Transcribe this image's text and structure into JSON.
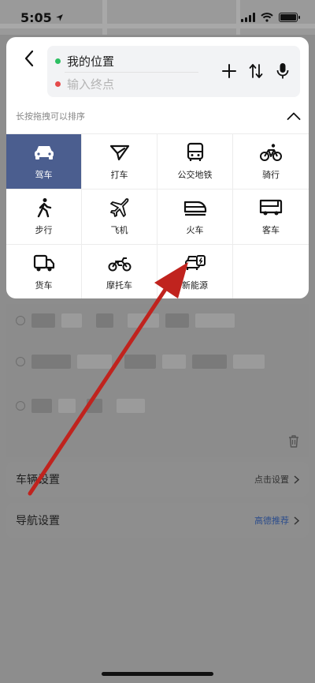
{
  "status": {
    "time": "5:05"
  },
  "route": {
    "start_label": "我的位置",
    "end_placeholder": "输入终点"
  },
  "hint": "长按拖拽可以排序",
  "modes": [
    {
      "label": "驾车",
      "icon": "car-icon",
      "active": true
    },
    {
      "label": "打车",
      "icon": "taxi-icon",
      "active": false
    },
    {
      "label": "公交地铁",
      "icon": "bus-icon",
      "active": false
    },
    {
      "label": "骑行",
      "icon": "bicycle-icon",
      "active": false
    },
    {
      "label": "步行",
      "icon": "walking-icon",
      "active": false
    },
    {
      "label": "飞机",
      "icon": "airplane-icon",
      "active": false
    },
    {
      "label": "火车",
      "icon": "train-icon",
      "active": false
    },
    {
      "label": "客车",
      "icon": "coach-icon",
      "active": false
    },
    {
      "label": "货车",
      "icon": "truck-icon",
      "active": false
    },
    {
      "label": "摩托车",
      "icon": "motorcycle-icon",
      "active": false
    },
    {
      "label": "新能源",
      "icon": "ev-car-icon",
      "active": false
    }
  ],
  "settings": {
    "vehicle": {
      "title": "车辆设置",
      "action": "点击设置"
    },
    "navigation": {
      "title": "导航设置",
      "tag": "高德推荐"
    }
  },
  "colors": {
    "accent": "#4b5e8f",
    "arrow": "#c0231e",
    "start_dot": "#2dbf62",
    "end_dot": "#e54b4b"
  }
}
